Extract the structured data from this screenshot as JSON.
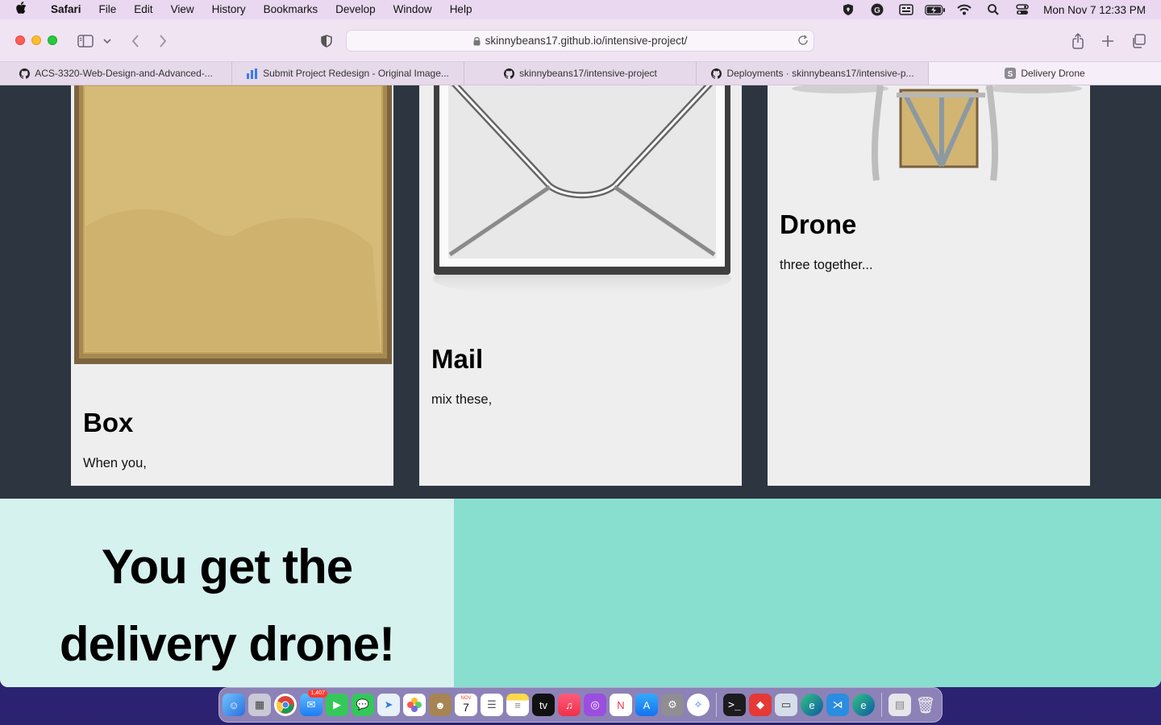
{
  "menubar": {
    "app_name": "Safari",
    "items": [
      "File",
      "Edit",
      "View",
      "History",
      "Bookmarks",
      "Develop",
      "Window",
      "Help"
    ],
    "clock": "Mon Nov 7  12:33 PM"
  },
  "browser": {
    "url": "skinnybeans17.github.io/intensive-project/",
    "tabs": [
      {
        "label": "ACS-3320-Web-Design-and-Advanced-...",
        "icon": "github-icon"
      },
      {
        "label": "Submit Project Redesign - Original Image...",
        "icon": "chart-icon"
      },
      {
        "label": "skinnybeans17/intensive-project",
        "icon": "github-icon"
      },
      {
        "label": "Deployments · skinnybeans17/intensive-p...",
        "icon": "github-icon"
      },
      {
        "label": "Delivery Drone",
        "icon": "s-icon",
        "active": true
      }
    ]
  },
  "cards": [
    {
      "title": "Box",
      "text": "When you,"
    },
    {
      "title": "Mail",
      "text": "mix these,"
    },
    {
      "title": "Drone",
      "text": "three together..."
    }
  ],
  "hero": {
    "line1": "You get the",
    "line2": "delivery drone!"
  },
  "dock": {
    "mail_badge": "1,407",
    "calendar_month": "NOV",
    "calendar_day": "7"
  },
  "colors": {
    "page_dark": "#2d3540",
    "card_bg": "#eeeeef",
    "hero_left": "#d5f2ee",
    "hero_right": "#88dfcf"
  }
}
